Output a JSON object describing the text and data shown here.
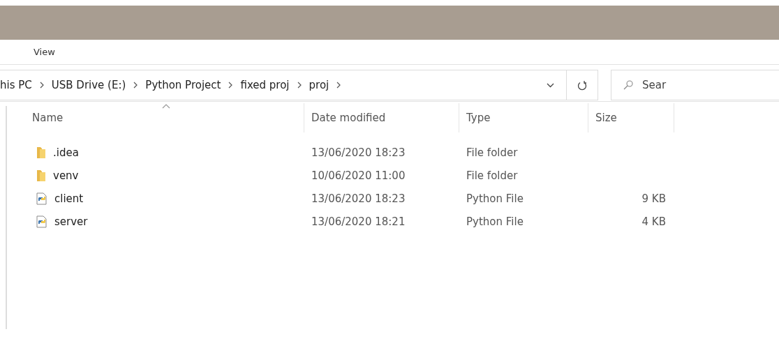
{
  "menu": [
    {
      "label": "View"
    }
  ],
  "breadcrumb": [
    "his PC",
    "USB Drive (E:)",
    "Python Project",
    "fixed proj",
    "proj"
  ],
  "search": {
    "placeholder": "Sear"
  },
  "table": {
    "columns": [
      "Name",
      "Date modified",
      "Type",
      "Size"
    ],
    "rows": [
      {
        "kind": "folder",
        "name": ".idea",
        "date": "13/06/2020 18:23",
        "type": "File folder"
      },
      {
        "kind": "folder",
        "name": "venv",
        "date": "10/06/2020 11:00",
        "type": "File folder"
      },
      {
        "kind": "python",
        "name": "client",
        "date": "13/06/2020 18:23",
        "type": "Python File",
        "size": "9 KB"
      },
      {
        "kind": "python",
        "name": "server",
        "date": "13/06/2020 18:21",
        "type": "Python File",
        "size": "4 KB"
      }
    ]
  }
}
